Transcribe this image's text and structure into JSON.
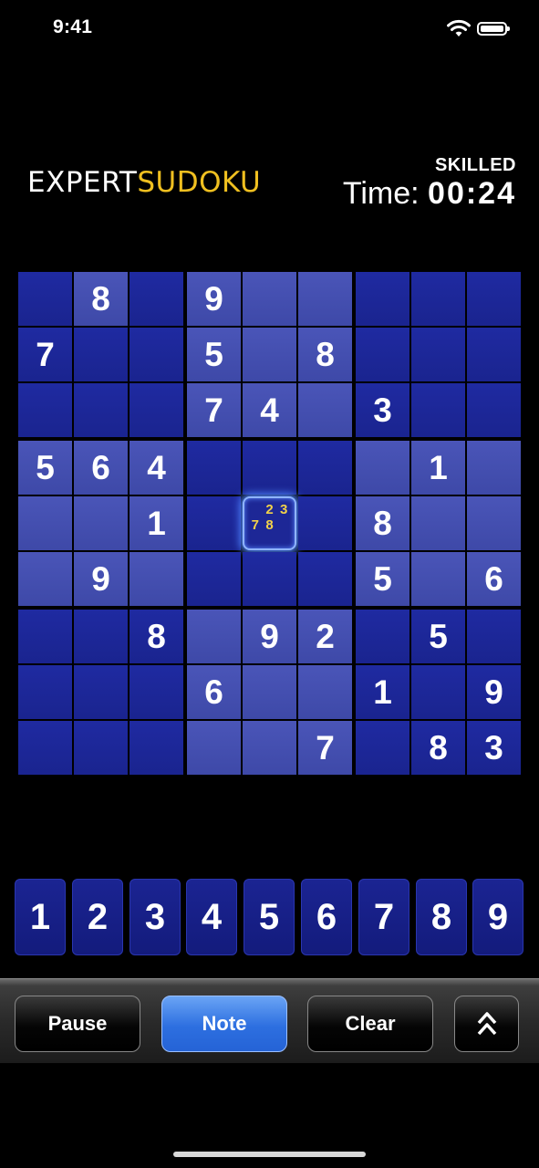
{
  "status": {
    "time": "9:41"
  },
  "header": {
    "logo_part1": "EXPERT",
    "logo_part2": "SUDOKU",
    "difficulty": "SKILLED",
    "time_label": "Time:",
    "time_value": "00:24"
  },
  "board": {
    "selected_cell": {
      "row": 5,
      "col": 5
    },
    "selected_notes": [
      "",
      "2",
      "3",
      "7",
      "8",
      "",
      "",
      "",
      ""
    ],
    "rows": [
      [
        "",
        "8",
        "",
        "9",
        "",
        "",
        "",
        "",
        ""
      ],
      [
        "7",
        "",
        "",
        "5",
        "",
        "8",
        "",
        "",
        ""
      ],
      [
        "",
        "",
        "",
        "7",
        "4",
        "",
        "3",
        "",
        ""
      ],
      [
        "5",
        "6",
        "4",
        "",
        "",
        "",
        "",
        "1",
        ""
      ],
      [
        "",
        "",
        "1",
        "",
        "",
        "",
        "8",
        "",
        ""
      ],
      [
        "",
        "9",
        "",
        "",
        "",
        "",
        "5",
        "",
        "6"
      ],
      [
        "",
        "",
        "8",
        "",
        "9",
        "2",
        "",
        "5",
        ""
      ],
      [
        "",
        "",
        "",
        "6",
        "",
        "",
        "1",
        "",
        "9"
      ],
      [
        "",
        "",
        "",
        "",
        "",
        "7",
        "",
        "8",
        "3"
      ]
    ],
    "shading": [
      [
        "dark",
        "light",
        "dark",
        "light",
        "light",
        "light",
        "dark",
        "dark",
        "dark"
      ],
      [
        "dark",
        "dark",
        "dark",
        "light",
        "light",
        "light",
        "dark",
        "dark",
        "dark"
      ],
      [
        "dark",
        "dark",
        "dark",
        "light",
        "light",
        "light",
        "dark",
        "dark",
        "dark"
      ],
      [
        "light",
        "light",
        "light",
        "dark",
        "dark",
        "dark",
        "light",
        "light",
        "light"
      ],
      [
        "light",
        "light",
        "light",
        "dark",
        "dark",
        "dark",
        "light",
        "light",
        "light"
      ],
      [
        "light",
        "light",
        "light",
        "dark",
        "dark",
        "dark",
        "light",
        "light",
        "light"
      ],
      [
        "dark",
        "dark",
        "dark",
        "light",
        "light",
        "light",
        "dark",
        "dark",
        "dark"
      ],
      [
        "dark",
        "dark",
        "dark",
        "light",
        "light",
        "light",
        "dark",
        "dark",
        "dark"
      ],
      [
        "dark",
        "dark",
        "dark",
        "light",
        "light",
        "light",
        "dark",
        "dark",
        "dark"
      ]
    ]
  },
  "numpad": [
    "1",
    "2",
    "3",
    "4",
    "5",
    "6",
    "7",
    "8",
    "9"
  ],
  "toolbar": {
    "pause_label": "Pause",
    "note_label": "Note",
    "clear_label": "Clear",
    "more_icon": "double-chevron-up-icon"
  },
  "colors": {
    "dark_cell": "#1f2aa1",
    "light_cell": "#4a55b8",
    "accent_gold": "#f0c020",
    "note_button": "#2d6fe0"
  }
}
